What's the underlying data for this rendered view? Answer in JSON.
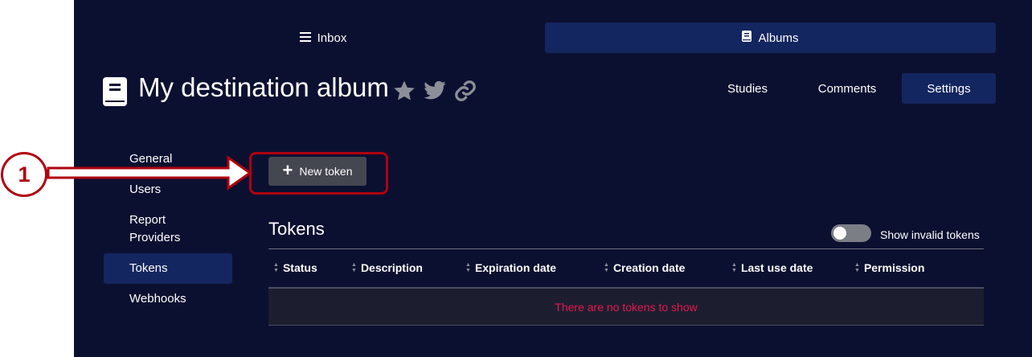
{
  "nav": {
    "inbox_label": "Inbox",
    "albums_label": "Albums"
  },
  "header": {
    "title": "My destination album",
    "tabs": [
      "Studies",
      "Comments",
      "Settings"
    ]
  },
  "sidebar": {
    "items": [
      {
        "label": "General"
      },
      {
        "label": "Users"
      },
      {
        "label": "Report Providers"
      },
      {
        "label": "Tokens"
      },
      {
        "label": "Webhooks"
      }
    ],
    "active": "Tokens"
  },
  "toolbar": {
    "new_token_label": "New token"
  },
  "tokens": {
    "section_title": "Tokens",
    "toggle_label": "Show invalid tokens",
    "columns": [
      "Status",
      "Description",
      "Expiration date",
      "Creation date",
      "Last use date",
      "Permission"
    ],
    "empty_message": "There are no tokens to show"
  },
  "annotation": {
    "step_number": "1"
  },
  "colors": {
    "background": "#0c1030",
    "accent": "#142660",
    "empty_text": "#e8174d",
    "annotation": "#b00010"
  }
}
